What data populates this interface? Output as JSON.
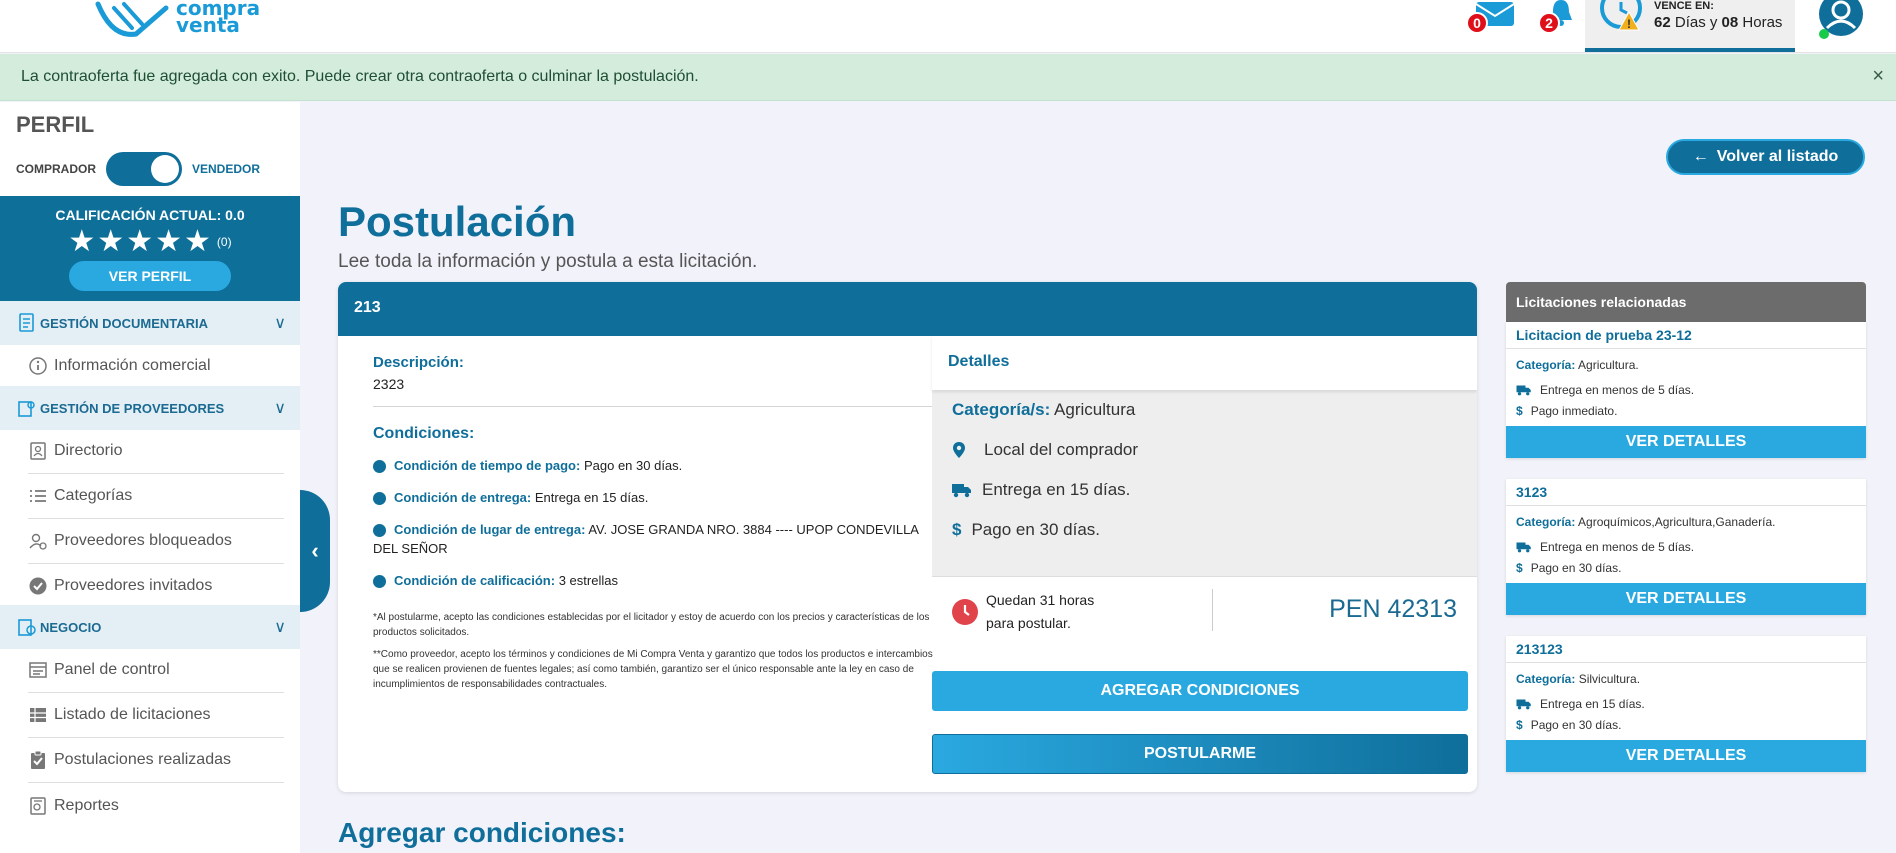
{
  "header": {
    "logo_line1": "compra",
    "logo_line2": "venta",
    "messages_count": "0",
    "notifications_count": "2",
    "vence_label": "VENCE EN:",
    "vence_days": "62",
    "vence_days_label": "Días y",
    "vence_hours": "08",
    "vence_hours_label": "Horas"
  },
  "alert": {
    "text": "La contraoferta fue agregada con exito. Puede crear otra contraoferta o culminar la postulación.",
    "close": "×"
  },
  "sidebar": {
    "perfil_title": "PERFIL",
    "role_left": "COMPRADOR",
    "role_right": "VENDEDOR",
    "rating_label": "CALIFICACIÓN ACTUAL: 0.0",
    "rating_value": 0.0,
    "stars_total": 5,
    "rating_count": "(0)",
    "ver_perfil": "VER PERFIL",
    "sections": [
      {
        "label": "GESTIÓN DOCUMENTARIA",
        "items": [
          {
            "label": "Información comercial",
            "icon": "info-icon"
          }
        ]
      },
      {
        "label": "GESTIÓN DE PROVEEDORES",
        "items": [
          {
            "label": "Directorio",
            "icon": "contact-book-icon"
          },
          {
            "label": "Categorías",
            "icon": "list-icon"
          },
          {
            "label": "Proveedores bloqueados",
            "icon": "user-blocked-icon"
          },
          {
            "label": "Proveedores invitados",
            "icon": "check-circle-icon"
          }
        ]
      },
      {
        "label": "NEGOCIO",
        "items": [
          {
            "label": "Panel de control",
            "icon": "dashboard-icon"
          },
          {
            "label": "Listado de licitaciones",
            "icon": "table-list-icon"
          },
          {
            "label": "Postulaciones realizadas",
            "icon": "clipboard-check-icon"
          },
          {
            "label": "Reportes",
            "icon": "report-icon"
          }
        ]
      }
    ]
  },
  "main": {
    "volver": "Volver al listado",
    "title": "Postulación",
    "subtitle": "Lee toda la información y postula a esta licitación.",
    "card_id": "213",
    "descripcion_label": "Descripción:",
    "descripcion_value": "2323",
    "condiciones_label": "Condiciones:",
    "condiciones": [
      {
        "label": "Condición de tiempo de pago:",
        "value": "Pago en 30 días."
      },
      {
        "label": "Condición de entrega:",
        "value": "Entrega en 15 días."
      },
      {
        "label": "Condición de lugar de entrega:",
        "value": "AV. JOSE GRANDA NRO. 3884 ---- UPOP CONDEVILLA DEL SEÑOR"
      },
      {
        "label": "Condición de calificación:",
        "value": "3 estrellas"
      }
    ],
    "fine_print_1": "*Al postularme, acepto las condiciones establecidas por el licitador y estoy de acuerdo con los precios y características de los productos solicitados.",
    "fine_print_2": "**Como proveedor, acepto los términos y condiciones de Mi Compra Venta y garantizo que todos los productos e intercambios que se realicen provienen de fuentes legales; así como también, garantizo ser el único responsable ante la ley en caso de incumplimientos de responsabilidades contractuales.",
    "detalles_label": "Detalles",
    "categoria_label": "Categoría/s:",
    "categoria_value": "Agricultura",
    "lugar": "Local del comprador",
    "entrega": "Entrega en 15 días.",
    "pago": "Pago en 30 días.",
    "quedan_line1": "Quedan 31 horas",
    "quedan_line2": "para postular.",
    "amount": "PEN 42313",
    "btn_agregar": "AGREGAR CONDICIONES",
    "btn_postular": "POSTULARME",
    "agregar_title": "Agregar condiciones:"
  },
  "related": {
    "title": "Licitaciones relacionadas",
    "categoria_label": "Categoría:",
    "ver_detalles": "VER DETALLES",
    "items": [
      {
        "title": "Licitacion de prueba 23-12",
        "categoria": "Agricultura.",
        "entrega": "Entrega en menos de 5 días.",
        "pago": "Pago inmediato."
      },
      {
        "title": "3123",
        "categoria": "Agroquímicos,Agricultura,Ganadería.",
        "entrega": "Entrega en menos de 5 días.",
        "pago": "Pago en 30 días."
      },
      {
        "title": "213123",
        "categoria": "Silvicultura.",
        "entrega": "Entrega en 15 días.",
        "pago": "Pago en 30 días."
      }
    ]
  },
  "colors": {
    "primary": "#0f6e9a",
    "accent": "#2aa9e0",
    "alert_bg": "#d3ecdc",
    "badge": "#e0101b",
    "related_header": "#6c6c6c"
  }
}
